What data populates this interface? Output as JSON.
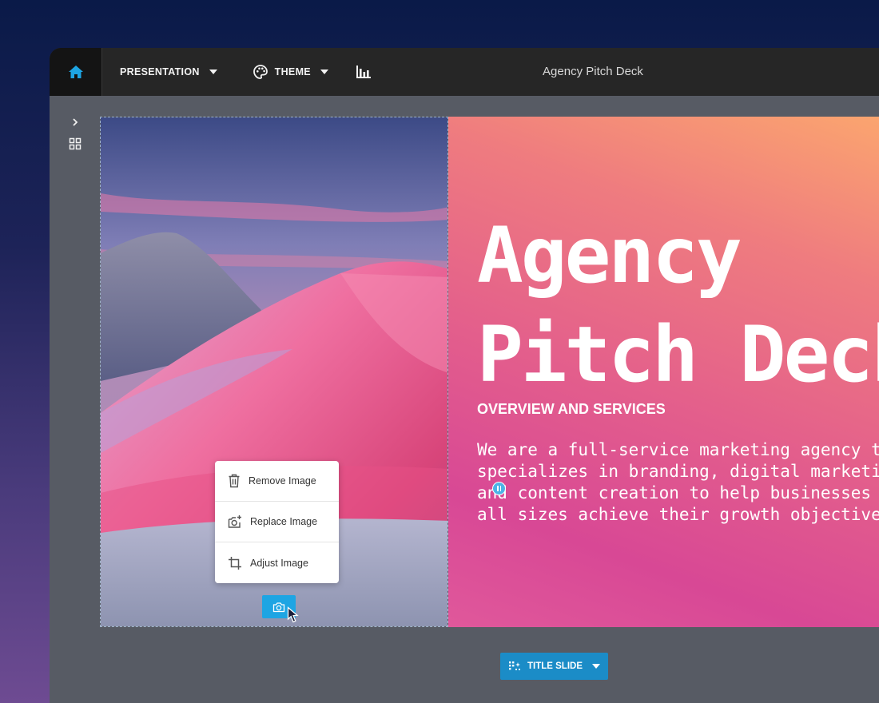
{
  "toolbar": {
    "presentation_label": "PRESENTATION",
    "theme_label": "THEME",
    "doc_title": "Agency Pitch Deck"
  },
  "slide": {
    "title_line1": "Agency",
    "title_line2": "Pitch Deck",
    "subtitle": "OVERVIEW AND SERVICES",
    "body": "We are a full-service marketing agency that specializes in branding, digital marketing, and content creation to help businesses of all sizes achieve their growth objectives"
  },
  "image_menu": {
    "items": [
      {
        "label": "Remove Image",
        "icon": "trash-icon"
      },
      {
        "label": "Replace Image",
        "icon": "camera-plus-icon"
      },
      {
        "label": "Adjust Image",
        "icon": "crop-icon"
      }
    ]
  },
  "layout_button": {
    "label": "TITLE SLIDE"
  },
  "colors": {
    "accent": "#1ea5e3",
    "home_icon": "#1ea5e3",
    "topbar": "#262626",
    "canvas": "#575b64",
    "layout_button": "#1b8cc7"
  }
}
